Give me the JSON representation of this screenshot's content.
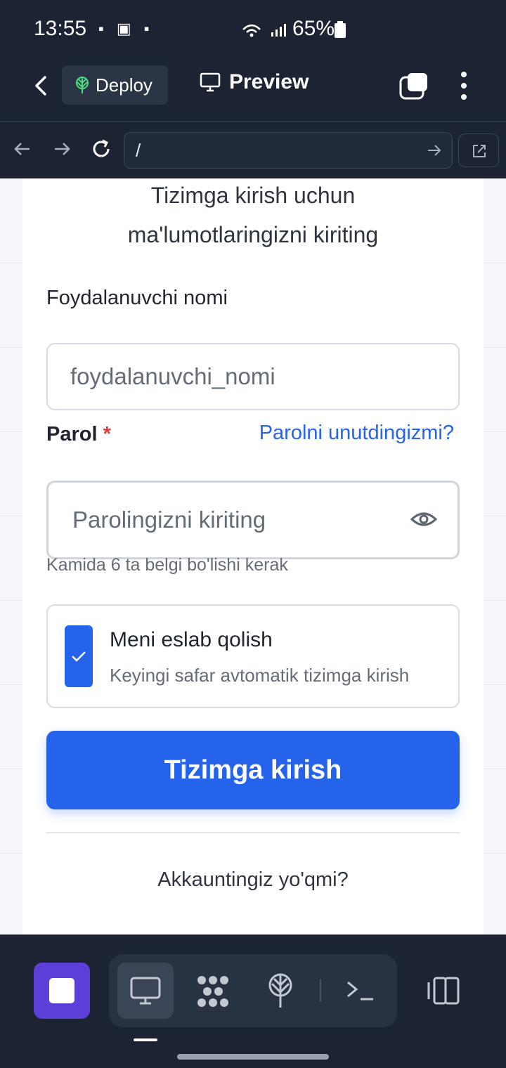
{
  "status_bar": {
    "time": "13:55",
    "battery": "65%"
  },
  "topbar": {
    "deploy_label": "Deploy",
    "preview_label": "Preview"
  },
  "browser": {
    "url": "/"
  },
  "login": {
    "subtitle_line1": "Tizimga kirish uchun",
    "subtitle_line2": "ma'lumotlaringizni kiriting",
    "username_label": "Foydalanuvchi nomi",
    "username_placeholder": "foydalanuvchi_nomi",
    "password_label": "Parol",
    "required_mark": "*",
    "forgot_link": "Parolni unutdingizmi?",
    "password_placeholder": "Parolingizni kiriting",
    "password_hint": "Kamida 6 ta belgi bo'lishi kerak",
    "remember_title": "Meni eslab qolish",
    "remember_subtitle": "Keyingi safar avtomatik tizimga kirish",
    "remember_checked": true,
    "submit_label": "Tizimga kirish",
    "no_account": "Akkauntingiz yo'qmi?"
  },
  "colors": {
    "accent": "#2563eb",
    "dark_bg": "#1c2433",
    "stop_button": "#5b3fd8",
    "deploy_icon": "#4ade80"
  },
  "icons": [
    "back-icon",
    "deploy-icon",
    "monitor-icon",
    "tabs-icon",
    "kebab-icon",
    "arrow-left-icon",
    "arrow-right-icon",
    "reload-icon",
    "go-icon",
    "external-link-icon",
    "eye-icon",
    "check-icon",
    "stop-icon",
    "grid-icon",
    "terminal-icon",
    "panel-icon"
  ]
}
